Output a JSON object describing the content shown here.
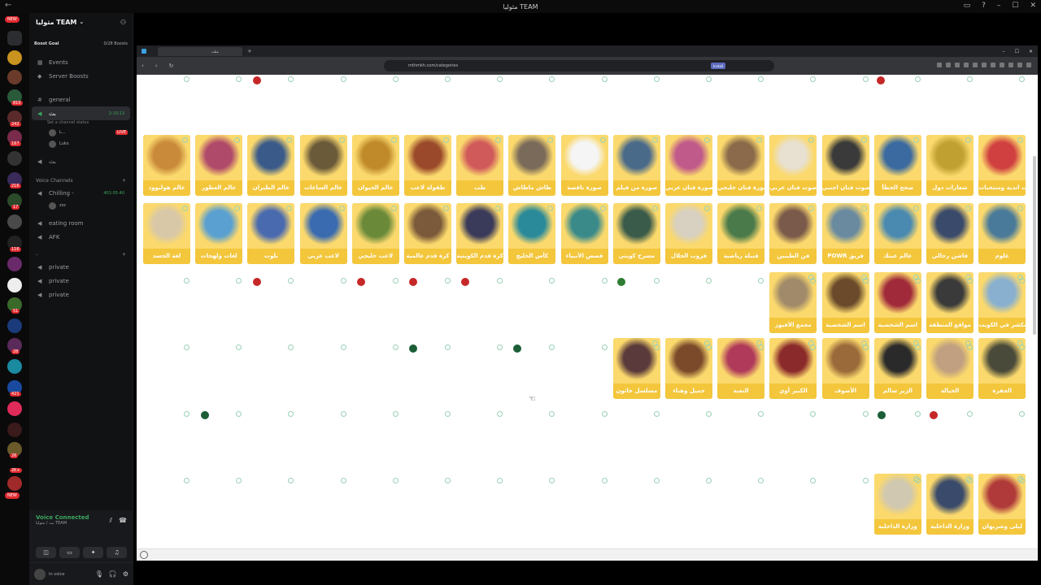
{
  "window": {
    "title": "مثوليا TEAM",
    "back_glyph": "←",
    "min": "–",
    "max": "☐",
    "close": "✕"
  },
  "server_rail": {
    "new_top": "NEW",
    "new_bottom": "NEW",
    "badges": [
      "810",
      "242",
      "167",
      "216",
      "17",
      "116",
      "51",
      "28",
      "421",
      "26",
      "2K+"
    ]
  },
  "sidebar": {
    "guild_name": "مثوليا TEAM",
    "boost_goal_label": "Boost Goal",
    "boost_count": "0/28 Boosts",
    "events": "Events",
    "server_boosts": "Server Boosts",
    "general": "general",
    "active_channel": "بث",
    "active_channel_time": "2:10:13",
    "channel_status": "Set a channel status",
    "user_1": "L...",
    "user_1_badge": "LIVE",
    "user_2": "Lukx",
    "channel_2": "بث",
    "voice_category": "Voice Channels",
    "chilling": "Chilling -",
    "chilling_time": "401:05:40",
    "user_3": "zzz",
    "eating_room": "eating room",
    "afk": "AFK",
    "category_2": "-",
    "private_1": "private",
    "private_2": "private",
    "private_3": "private"
  },
  "voice_panel": {
    "title": "Voice Connected",
    "subtitle": "بث / مثوليا TEAM"
  },
  "userbar": {
    "status": "In voice"
  },
  "browser": {
    "tab_title": "مثلث",
    "url": "mthmkh.com/categories",
    "install_label": "Install"
  },
  "cards": [
    {
      "label": "عالم هوليوود",
      "color": "#c98a3a"
    },
    {
      "label": "عالم العطور",
      "color": "#b04a6a"
    },
    {
      "label": "عالم الطيران",
      "color": "#3a5a8a"
    },
    {
      "label": "عالم الساعات",
      "color": "#6a5a3a"
    },
    {
      "label": "عالم الحيوان",
      "color": "#c08a2a"
    },
    {
      "label": "طفولة لاعب",
      "color": "#9a4a2a"
    },
    {
      "label": "طب",
      "color": "#d05a5a"
    },
    {
      "label": "طاش ماطاش",
      "color": "#7a6a5a"
    },
    {
      "label": "صورة ناقصة",
      "color": "#f5f5f5"
    },
    {
      "label": "صورة من فيلم",
      "color": "#4a6a8a"
    },
    {
      "label": "صورة فنان عربي",
      "color": "#c05a8a"
    },
    {
      "label": "صورة فنان خليجي",
      "color": "#8a6a4a"
    },
    {
      "label": "صوت فنان عربي",
      "color": "#e8e0d0"
    },
    {
      "label": "صوت فنان اجنبي",
      "color": "#3a3a3a"
    },
    {
      "label": "صحح الخطأ",
      "color": "#3a6aa0"
    },
    {
      "label": "شعارات دول",
      "color": "#c0a030"
    },
    {
      "label": "شعارات اندية ومنتخبات",
      "color": "#d04040"
    },
    {
      "label": "لغة الجسد",
      "color": "#d8c8a8"
    },
    {
      "label": "لغات ولهجات",
      "color": "#5aa0d0"
    },
    {
      "label": "بلوت",
      "color": "#4a6ab0"
    },
    {
      "label": "لاعب عربي",
      "color": "#3a6ab0"
    },
    {
      "label": "لاعب خليجي",
      "color": "#6a8a3a"
    },
    {
      "label": "كرة قدم عالمية",
      "color": "#7a5a3a"
    },
    {
      "label": "كرة قدم الكويتية",
      "color": "#3a3a5a"
    },
    {
      "label": "كأس الخليج",
      "color": "#2a8a9a"
    },
    {
      "label": "قصص الأنبياء",
      "color": "#3a8a8a"
    },
    {
      "label": "مسرح كويتي",
      "color": "#3a5a4a"
    },
    {
      "label": "قروب الحلال",
      "color": "#d8d0c0"
    },
    {
      "label": "قنبلة رياضية",
      "color": "#4a7a4a"
    },
    {
      "label": "فن الطيبين",
      "color": "#7a5a4a"
    },
    {
      "label": "POWR فريق",
      "color": "#6a8aa0"
    },
    {
      "label": "عالم عينك",
      "color": "#4a8ab0"
    },
    {
      "label": "فاشن رجالي",
      "color": "#3a4a6a"
    },
    {
      "label": "علوم",
      "color": "#4a7a9a"
    },
    {
      "label": "مجمع الأفيوز",
      "color": "#a08a6a"
    },
    {
      "label": "اسم الشخصية",
      "color": "#6a4a2a"
    },
    {
      "label": "اسم الشخصية",
      "color": "#a02a3a"
    },
    {
      "label": "مواقع المنطقة",
      "color": "#3a3a3a"
    },
    {
      "label": "المكشر في الكويت",
      "color": "#8ab0d0"
    },
    {
      "label": "مسلسل خاتون",
      "color": "#5a3a3a"
    },
    {
      "label": "جميل وهناء",
      "color": "#7a4a2a"
    },
    {
      "label": "النعبة",
      "color": "#b03a5a"
    },
    {
      "label": "الكبير أوي",
      "color": "#8a2a2a"
    },
    {
      "label": "الأصوف",
      "color": "#9a6a3a"
    },
    {
      "label": "الزير سالم",
      "color": "#2a2a2a"
    },
    {
      "label": "الخيالة",
      "color": "#c0a080"
    },
    {
      "label": "الحفرة",
      "color": "#4a4a3a"
    },
    {
      "label": "وزارة الداخلية",
      "color": "#d0c8b0"
    },
    {
      "label": "وزارة الداخلية",
      "color": "#3a4a6a"
    },
    {
      "label": "ليلى وشريهان",
      "color": "#b03a3a"
    }
  ]
}
